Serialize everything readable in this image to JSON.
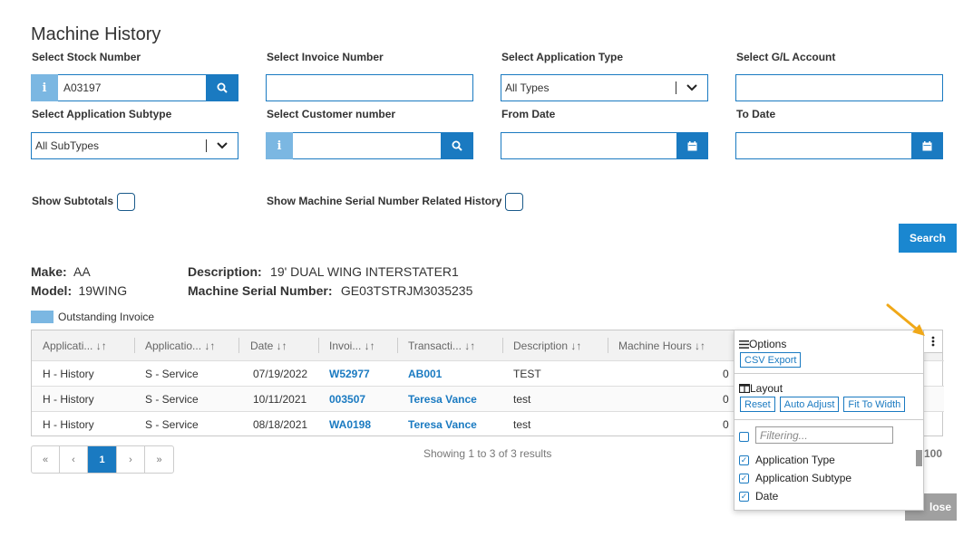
{
  "page": {
    "title": "Machine History"
  },
  "filters": {
    "stock_number": {
      "label": "Select Stock Number",
      "value": "A03197"
    },
    "invoice_number": {
      "label": "Select Invoice Number",
      "value": ""
    },
    "application_type": {
      "label": "Select Application Type",
      "value": "All Types"
    },
    "gl_account": {
      "label": "Select G/L Account",
      "value": ""
    },
    "application_subtype": {
      "label": "Select Application Subtype",
      "value": "All SubTypes"
    },
    "customer_number": {
      "label": "Select Customer number",
      "value": ""
    },
    "from_date": {
      "label": "From Date",
      "value": ""
    },
    "to_date": {
      "label": "To Date",
      "value": ""
    },
    "show_subtotals": {
      "label": "Show Subtotals",
      "checked": false
    },
    "show_serial_history": {
      "label": "Show Machine Serial Number Related History",
      "checked": false
    },
    "search_button": "Search"
  },
  "machine_info": {
    "make_label": "Make:",
    "make": "AA",
    "model_label": "Model:",
    "model": "19WING",
    "description_label": "Description:",
    "description": "19' DUAL WING INTERSTATER1",
    "serial_label": "Machine Serial Number:",
    "serial": "GE03TSTRJM3035235"
  },
  "legend": {
    "outstanding_label": "Outstanding Invoice",
    "outstanding_color": "#7bb7e2"
  },
  "table": {
    "columns": [
      "Applicati... ↓↑",
      "Applicatio... ↓↑",
      "Date ↓↑",
      "Invoi... ↓↑",
      "Transacti... ↓↑",
      "Description ↓↑",
      "Machine Hours ↓↑"
    ],
    "rows": [
      {
        "app_type": "H - History",
        "app_subtype": "S - Service",
        "date": "07/19/2022",
        "invoice": "W52977",
        "transaction": "AB001",
        "description": "TEST",
        "hours": "0"
      },
      {
        "app_type": "H - History",
        "app_subtype": "S - Service",
        "date": "10/11/2021",
        "invoice": "003507",
        "transaction": "Teresa Vance",
        "description": "test",
        "hours": "0"
      },
      {
        "app_type": "H - History",
        "app_subtype": "S - Service",
        "date": "08/18/2021",
        "invoice": "WA0198",
        "transaction": "Teresa Vance",
        "description": "test",
        "hours": "0"
      }
    ]
  },
  "pagination": {
    "first": "«",
    "prev": "‹",
    "current": "1",
    "next": "›",
    "last": "»",
    "summary": "Showing 1 to 3 of 3 results",
    "page_size": "100"
  },
  "column_menu": {
    "options_title": "Options",
    "csv_export": "CSV Export",
    "layout_title": "Layout",
    "reset": "Reset",
    "auto_adjust": "Auto Adjust",
    "fit_to_width": "Fit To Width",
    "filter_placeholder": "Filtering...",
    "columns": [
      {
        "label": "Application Type",
        "checked": true
      },
      {
        "label": "Application Subtype",
        "checked": true
      },
      {
        "label": "Date",
        "checked": true
      }
    ]
  },
  "footer": {
    "close_label": "lose"
  },
  "colors": {
    "primary": "#1a7ac1",
    "arrow": "#f0a818"
  }
}
